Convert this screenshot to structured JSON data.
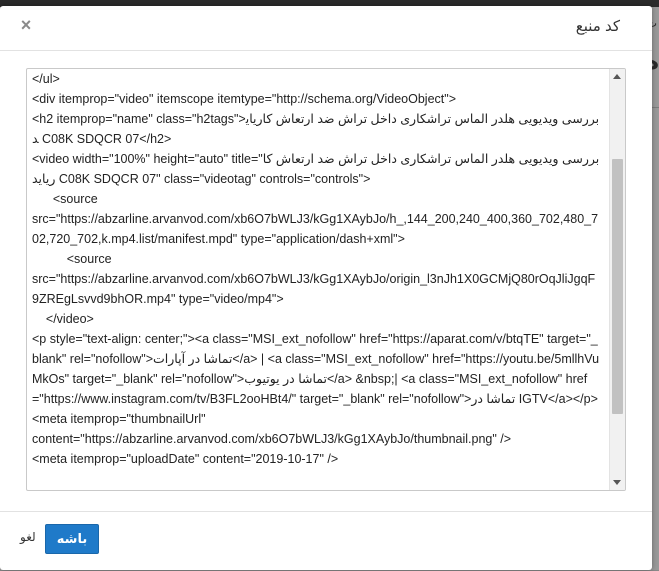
{
  "dialog": {
    "title": "کد منبع",
    "close_glyph": "×",
    "ok_label": "باشه",
    "cancel_label": "لغو"
  },
  "source_code": {
    "lines": [
      "</ul>",
      "<div itemprop=\"video\" itemscope itemtype=\"http://schema.org/VideoObject\">",
      "<h2 itemprop=\"name\" class=\"h2tags\">بررسی ویدیویی هلدر الماس تراشکاری داخل تراش ضد ارتعاش کاریاید C08K SDQCR 07</h2>",
      "<video width=\"100%\" height=\"auto\" title=\"بررسی ویدیویی هلدر الماس تراشکاری داخل تراش ضد ارتعاش کاریاید C08K SDQCR 07\" class=\"videotag\" controls=\"controls\">",
      "      <source",
      "src=\"https://abzarline.arvanvod.com/xb6O7bWLJ3/kGg1XAybJo/h_,144_200,240_400,360_702,480_702,720_702,k.mp4.list/manifest.mpd\" type=\"application/dash+xml\">",
      "          <source",
      "src=\"https://abzarline.arvanvod.com/xb6O7bWLJ3/kGg1XAybJo/origin_l3nJh1X0GCMjQ80rOqJliJgqF9ZREgLsvvd9bhOR.mp4\" type=\"video/mp4\">",
      "    </video>",
      "<p style=\"text-align: center;\"><a class=\"MSI_ext_nofollow\" href=\"https://aparat.com/v/btqTE\" target=\"_blank\" rel=\"nofollow\">تماشا در آپارات</a> | <a class=\"MSI_ext_nofollow\" href=\"https://youtu.be/5mllhVuMkOs\" target=\"_blank\" rel=\"nofollow\">تماشا در یوتیوب</a> &nbsp;| <a class=\"MSI_ext_nofollow\" href=\"https://www.instagram.com/tv/B3FL2ooHBt4/\" target=\"_blank\" rel=\"nofollow\">تماشا در IGTV</a></p>",
      "<meta itemprop=\"thumbnailUrl\"",
      "content=\"https://abzarline.arvanvod.com/xb6O7bWLJ3/kGg1XAybJo/thumbnail.png\" />",
      "<meta itemprop=\"uploadDate\" content=\"2019-10-17\" />"
    ]
  },
  "background": {
    "frag_top_right": "ت",
    "frag_right_2": "ه",
    "frag_left_1": "O",
    "frag_left_2": "ـل",
    "frag_left_3": "ی",
    "frag_left_4": "ت"
  }
}
